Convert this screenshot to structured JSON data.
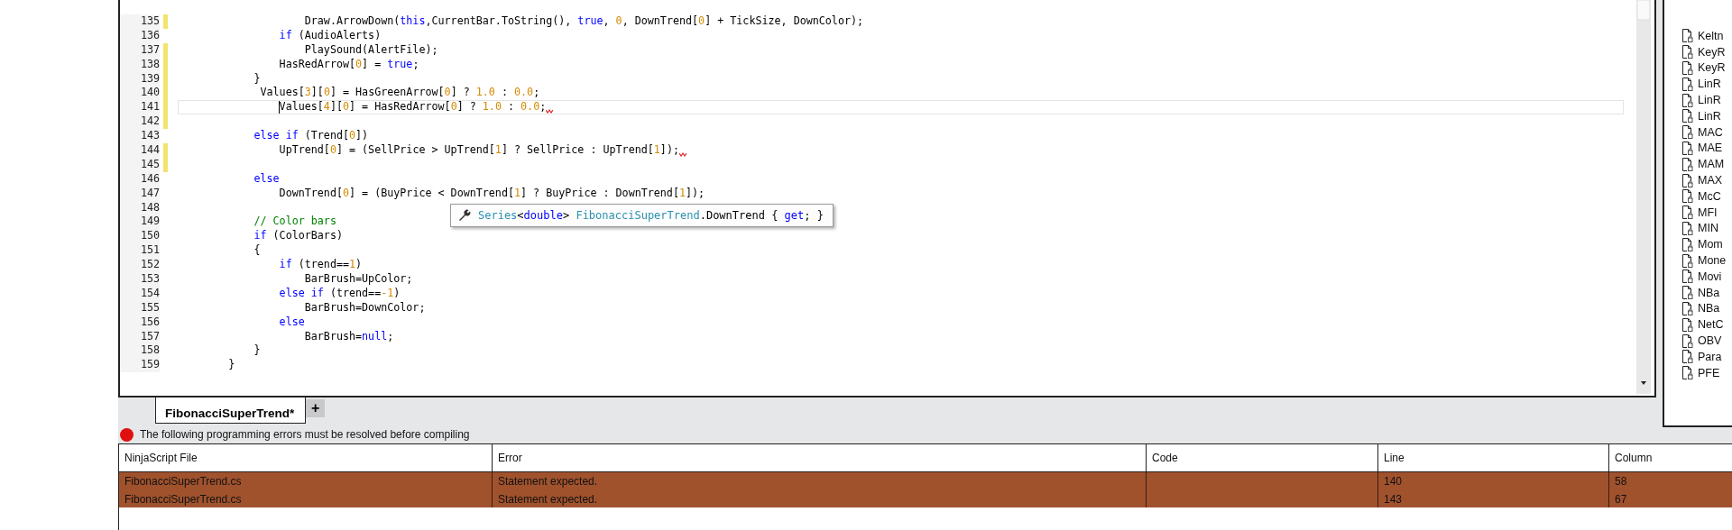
{
  "editor": {
    "lines": [
      {
        "number": "135",
        "changed": true,
        "current": false,
        "squiggle": false,
        "tokens": [
          {
            "kind": "plain",
            "text": "                    Draw.ArrowDown("
          },
          {
            "kind": "keyword",
            "text": "this"
          },
          {
            "kind": "plain",
            "text": ",CurrentBar.ToString(), "
          },
          {
            "kind": "keyword",
            "text": "true"
          },
          {
            "kind": "plain",
            "text": ", "
          },
          {
            "kind": "number",
            "text": "0"
          },
          {
            "kind": "plain",
            "text": ", DownTrend["
          },
          {
            "kind": "number",
            "text": "0"
          },
          {
            "kind": "plain",
            "text": "] + TickSize, DownColor);"
          }
        ]
      },
      {
        "number": "136",
        "changed": false,
        "current": false,
        "squiggle": false,
        "tokens": [
          {
            "kind": "keyword",
            "text": "                if"
          },
          {
            "kind": "plain",
            "text": " (AudioAlerts)"
          }
        ]
      },
      {
        "number": "137",
        "changed": true,
        "current": false,
        "squiggle": false,
        "tokens": [
          {
            "kind": "plain",
            "text": "                    PlaySound(AlertFile);"
          }
        ]
      },
      {
        "number": "138",
        "changed": true,
        "current": false,
        "squiggle": false,
        "tokens": [
          {
            "kind": "plain",
            "text": "                HasRedArrow["
          },
          {
            "kind": "number",
            "text": "0"
          },
          {
            "kind": "plain",
            "text": "] = "
          },
          {
            "kind": "keyword",
            "text": "true"
          },
          {
            "kind": "plain",
            "text": ";"
          }
        ]
      },
      {
        "number": "139",
        "changed": true,
        "current": false,
        "squiggle": false,
        "tokens": [
          {
            "kind": "plain",
            "text": "            }"
          }
        ]
      },
      {
        "number": "140",
        "changed": true,
        "current": false,
        "squiggle": false,
        "tokens": [
          {
            "kind": "plain",
            "text": "             Values["
          },
          {
            "kind": "number",
            "text": "3"
          },
          {
            "kind": "plain",
            "text": "]["
          },
          {
            "kind": "number",
            "text": "0"
          },
          {
            "kind": "plain",
            "text": "] = HasGreenArrow["
          },
          {
            "kind": "number",
            "text": "0"
          },
          {
            "kind": "plain",
            "text": "] ? "
          },
          {
            "kind": "number",
            "text": "1.0"
          },
          {
            "kind": "plain",
            "text": " : "
          },
          {
            "kind": "number",
            "text": "0.0"
          },
          {
            "kind": "plain",
            "text": ";"
          }
        ]
      },
      {
        "number": "141",
        "changed": true,
        "current": true,
        "squiggle": true,
        "tokens": [
          {
            "kind": "plain",
            "text": "                Values["
          },
          {
            "kind": "number",
            "text": "4"
          },
          {
            "kind": "plain",
            "text": "]["
          },
          {
            "kind": "number",
            "text": "0"
          },
          {
            "kind": "plain",
            "text": "] = HasRedArrow["
          },
          {
            "kind": "number",
            "text": "0"
          },
          {
            "kind": "plain",
            "text": "] ? "
          },
          {
            "kind": "number",
            "text": "1.0"
          },
          {
            "kind": "plain",
            "text": " : "
          },
          {
            "kind": "number",
            "text": "0.0"
          },
          {
            "kind": "plain",
            "text": ";"
          }
        ]
      },
      {
        "number": "142",
        "changed": true,
        "current": false,
        "squiggle": false
      },
      {
        "number": "143",
        "changed": false,
        "current": false,
        "squiggle": false,
        "tokens": [
          {
            "kind": "keyword",
            "text": "            else if"
          },
          {
            "kind": "plain",
            "text": " (Trend["
          },
          {
            "kind": "number",
            "text": "0"
          },
          {
            "kind": "plain",
            "text": "])"
          }
        ]
      },
      {
        "number": "144",
        "changed": true,
        "current": false,
        "squiggle": true,
        "tokens": [
          {
            "kind": "plain",
            "text": "                UpTrend["
          },
          {
            "kind": "number",
            "text": "0"
          },
          {
            "kind": "plain",
            "text": "] = (SellPrice > UpTrend["
          },
          {
            "kind": "number",
            "text": "1"
          },
          {
            "kind": "plain",
            "text": "] ? SellPrice : UpTrend["
          },
          {
            "kind": "number",
            "text": "1"
          },
          {
            "kind": "plain",
            "text": "]);"
          }
        ]
      },
      {
        "number": "145",
        "changed": true,
        "current": false,
        "squiggle": false
      },
      {
        "number": "146",
        "changed": false,
        "current": false,
        "squiggle": false,
        "tokens": [
          {
            "kind": "keyword",
            "text": "            else"
          }
        ]
      },
      {
        "number": "147",
        "changed": false,
        "current": false,
        "squiggle": false,
        "tokens": [
          {
            "kind": "plain",
            "text": "                DownTrend["
          },
          {
            "kind": "number",
            "text": "0"
          },
          {
            "kind": "plain",
            "text": "] = (BuyPrice < DownTrend["
          },
          {
            "kind": "number",
            "text": "1"
          },
          {
            "kind": "plain",
            "text": "] ? BuyPrice : DownTrend["
          },
          {
            "kind": "number",
            "text": "1"
          },
          {
            "kind": "plain",
            "text": "]);"
          }
        ]
      },
      {
        "number": "148",
        "changed": false,
        "current": false,
        "squiggle": false
      },
      {
        "number": "149",
        "changed": false,
        "current": false,
        "squiggle": false,
        "tokens": [
          {
            "kind": "comment",
            "text": "            // Color bars"
          }
        ]
      },
      {
        "number": "150",
        "changed": false,
        "current": false,
        "squiggle": false,
        "tokens": [
          {
            "kind": "keyword",
            "text": "            if"
          },
          {
            "kind": "plain",
            "text": " (ColorBars)"
          }
        ]
      },
      {
        "number": "151",
        "changed": false,
        "current": false,
        "squiggle": false,
        "tokens": [
          {
            "kind": "plain",
            "text": "            {"
          }
        ]
      },
      {
        "number": "152",
        "changed": false,
        "current": false,
        "squiggle": false,
        "tokens": [
          {
            "kind": "keyword",
            "text": "                if"
          },
          {
            "kind": "plain",
            "text": " (trend=="
          },
          {
            "kind": "number",
            "text": "1"
          },
          {
            "kind": "plain",
            "text": ")"
          }
        ]
      },
      {
        "number": "153",
        "changed": false,
        "current": false,
        "squiggle": false,
        "tokens": [
          {
            "kind": "plain",
            "text": "                    BarBrush=UpColor;"
          }
        ]
      },
      {
        "number": "154",
        "changed": false,
        "current": false,
        "squiggle": false,
        "tokens": [
          {
            "kind": "keyword",
            "text": "                else if"
          },
          {
            "kind": "plain",
            "text": " (trend=="
          },
          {
            "kind": "number",
            "text": "-1"
          },
          {
            "kind": "plain",
            "text": ")"
          }
        ]
      },
      {
        "number": "155",
        "changed": false,
        "current": false,
        "squiggle": false,
        "tokens": [
          {
            "kind": "plain",
            "text": "                    BarBrush=DownColor;"
          }
        ]
      },
      {
        "number": "156",
        "changed": false,
        "current": false,
        "squiggle": false,
        "tokens": [
          {
            "kind": "keyword",
            "text": "                else"
          }
        ]
      },
      {
        "number": "157",
        "changed": false,
        "current": false,
        "squiggle": false,
        "tokens": [
          {
            "kind": "plain",
            "text": "                    BarBrush="
          },
          {
            "kind": "keyword",
            "text": "null"
          },
          {
            "kind": "plain",
            "text": ";"
          }
        ]
      },
      {
        "number": "158",
        "changed": false,
        "current": false,
        "squiggle": false,
        "tokens": [
          {
            "kind": "plain",
            "text": "            }"
          }
        ]
      },
      {
        "number": "159",
        "changed": false,
        "current": false,
        "squiggle": false,
        "tokens": [
          {
            "kind": "plain",
            "text": "        }"
          }
        ]
      }
    ],
    "tooltip": {
      "tokens": [
        {
          "kind": "type",
          "text": "Series"
        },
        {
          "kind": "plain",
          "text": "<"
        },
        {
          "kind": "keyword",
          "text": "double"
        },
        {
          "kind": "plain",
          "text": "> "
        },
        {
          "kind": "type",
          "text": "FibonacciSuperTrend"
        },
        {
          "kind": "plain",
          "text": ".DownTrend { "
        },
        {
          "kind": "keyword",
          "text": "get"
        },
        {
          "kind": "plain",
          "text": "; }"
        }
      ]
    }
  },
  "files": [
    "Keltn",
    "KeyR",
    "KeyR",
    "LinR",
    "LinR",
    "LinR",
    "MAC",
    "MAE",
    "MAM",
    "MAX",
    "McC",
    "MFI",
    "MIN",
    "Mom",
    "Mone",
    "Movi",
    "NBa",
    "NBa",
    "NetC",
    "OBV",
    "Para",
    "PFE"
  ],
  "tabs": [
    {
      "label": "FibonacciSuperTrend*",
      "selected": true
    }
  ],
  "new_tab": "+",
  "errors": {
    "message": "The following programming errors must be resolved before compiling",
    "columns": [
      "NinjaScript File",
      "Error",
      "Code",
      "Line",
      "Column"
    ],
    "rows": [
      {
        "cells": [
          "FibonacciSuperTrend.cs",
          "Statement expected.",
          "",
          "140",
          "58"
        ]
      },
      {
        "cells": [
          "FibonacciSuperTrend.cs",
          "Statement expected.",
          "",
          "143",
          "67"
        ]
      }
    ]
  }
}
